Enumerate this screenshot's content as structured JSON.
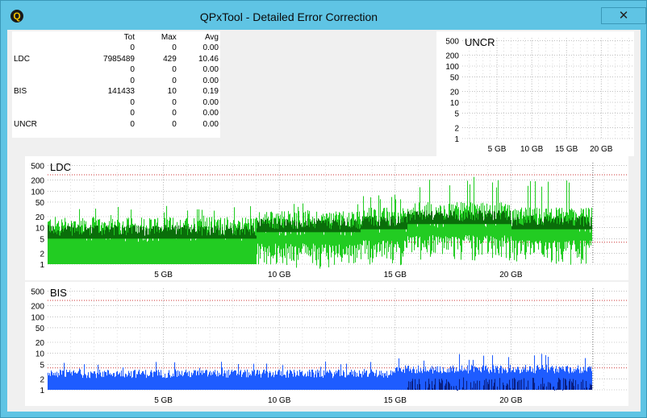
{
  "window": {
    "title": "QPxTool - Detailed Error Correction",
    "app_icon": "Q",
    "close_glyph": "✕"
  },
  "stats": {
    "headers": [
      "",
      "Tot",
      "Max",
      "Avg"
    ],
    "rows": [
      {
        "label": "",
        "tot": "0",
        "max": "0",
        "avg": "0.00"
      },
      {
        "label": "LDC",
        "tot": "7985489",
        "max": "429",
        "avg": "10.46"
      },
      {
        "label": "",
        "tot": "0",
        "max": "0",
        "avg": "0.00"
      },
      {
        "label": "",
        "tot": "0",
        "max": "0",
        "avg": "0.00"
      },
      {
        "label": "BIS",
        "tot": "141433",
        "max": "10",
        "avg": "0.19"
      },
      {
        "label": "",
        "tot": "0",
        "max": "0",
        "avg": "0.00"
      },
      {
        "label": "",
        "tot": "0",
        "max": "0",
        "avg": "0.00"
      },
      {
        "label": "UNCR",
        "tot": "0",
        "max": "0",
        "avg": "0.00"
      }
    ]
  },
  "colors": {
    "ldc_fill": "#22cc22",
    "ldc_dark": "#0a6e0a",
    "bis_fill": "#1e5cff",
    "bis_dark": "#0a1f80",
    "grid": "#9a9a9a",
    "threshold": "#cc3333"
  },
  "chart_data": [
    {
      "type": "area",
      "title": "UNCR",
      "y_scale": "log",
      "y_ticks": [
        "500",
        "200",
        "100",
        "50",
        "20",
        "10",
        "5",
        "2",
        "1"
      ],
      "x_ticks": [
        "5 GB",
        "10 GB",
        "15 GB",
        "20 GB"
      ],
      "series": [
        {
          "values": []
        }
      ]
    },
    {
      "type": "area",
      "title": "LDC",
      "y_scale": "log",
      "y_ticks": [
        "500",
        "200",
        "100",
        "50",
        "20",
        "10",
        "5",
        "2",
        "1"
      ],
      "x_ticks": [
        "5 GB",
        "10 GB",
        "15 GB",
        "20 GB"
      ],
      "threshold_upper": 280,
      "threshold_lower": 4,
      "x_end_gb": 23.5,
      "segments": [
        {
          "from_gb": 0,
          "to_gb": 9,
          "typical": 10,
          "peak": 40
        },
        {
          "from_gb": 9,
          "to_gb": 13.5,
          "typical": 15,
          "peak": 50
        },
        {
          "from_gb": 13.5,
          "to_gb": 15.5,
          "typical": 18,
          "peak": 80
        },
        {
          "from_gb": 15.5,
          "to_gb": 20,
          "typical": 25,
          "peak": 250
        },
        {
          "from_gb": 20,
          "to_gb": 23.5,
          "typical": 18,
          "peak": 200
        }
      ]
    },
    {
      "type": "area",
      "title": "BIS",
      "y_scale": "log",
      "y_ticks": [
        "500",
        "200",
        "100",
        "50",
        "20",
        "10",
        "5",
        "2",
        "1"
      ],
      "x_ticks": [
        "5 GB",
        "10 GB",
        "15 GB",
        "20 GB"
      ],
      "threshold_upper": 280,
      "threshold_lower": 4,
      "x_end_gb": 23.5,
      "segments": [
        {
          "from_gb": 0,
          "to_gb": 15,
          "typical": 3,
          "peak": 6
        },
        {
          "from_gb": 15,
          "to_gb": 23.5,
          "typical": 4,
          "peak": 10
        }
      ]
    }
  ]
}
